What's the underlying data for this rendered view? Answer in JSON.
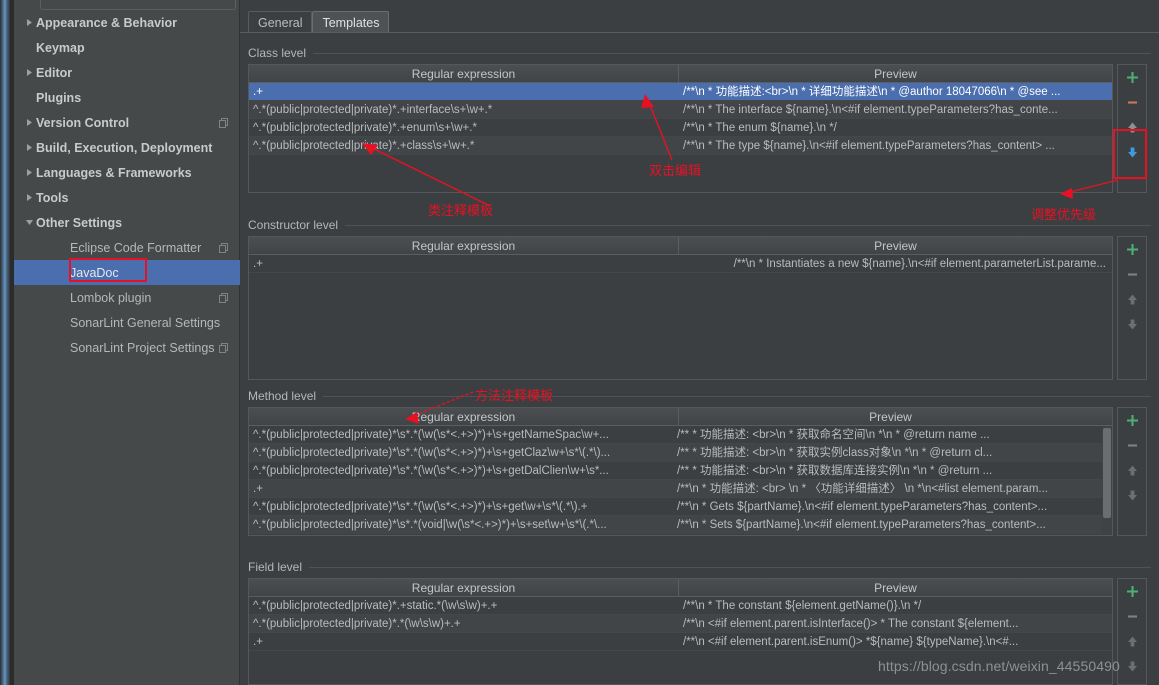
{
  "window": {
    "accent_blue": "#4b6eaf",
    "annotation_red": "#e81123",
    "bg": "#3c3f41",
    "sidebar_bg": "#45494a"
  },
  "search": {
    "value": "",
    "placeholder": ""
  },
  "sidebar": {
    "items": [
      {
        "label": "Appearance & Behavior",
        "level": "top",
        "twisty": "collapsed",
        "copy": false,
        "selected": false
      },
      {
        "label": "Keymap",
        "level": "top",
        "twisty": "none",
        "copy": false,
        "selected": false
      },
      {
        "label": "Editor",
        "level": "top",
        "twisty": "collapsed",
        "copy": false,
        "selected": false
      },
      {
        "label": "Plugins",
        "level": "top",
        "twisty": "none",
        "copy": false,
        "selected": false
      },
      {
        "label": "Version Control",
        "level": "top",
        "twisty": "collapsed",
        "copy": true,
        "selected": false
      },
      {
        "label": "Build, Execution, Deployment",
        "level": "top",
        "twisty": "collapsed",
        "copy": false,
        "selected": false
      },
      {
        "label": "Languages & Frameworks",
        "level": "top",
        "twisty": "collapsed",
        "copy": false,
        "selected": false
      },
      {
        "label": "Tools",
        "level": "top",
        "twisty": "collapsed",
        "copy": false,
        "selected": false
      },
      {
        "label": "Other Settings",
        "level": "top",
        "twisty": "expanded",
        "copy": false,
        "selected": false
      },
      {
        "label": "Eclipse Code Formatter",
        "level": "child",
        "twisty": "none",
        "copy": true,
        "selected": false
      },
      {
        "label": "JavaDoc",
        "level": "child",
        "twisty": "none",
        "copy": false,
        "selected": true
      },
      {
        "label": "Lombok plugin",
        "level": "child",
        "twisty": "none",
        "copy": true,
        "selected": false
      },
      {
        "label": "SonarLint General Settings",
        "level": "child",
        "twisty": "none",
        "copy": false,
        "selected": false
      },
      {
        "label": "SonarLint Project Settings",
        "level": "child",
        "twisty": "none",
        "copy": true,
        "selected": false
      }
    ]
  },
  "tabs": [
    {
      "label": "General",
      "active": false
    },
    {
      "label": "Templates",
      "active": true
    }
  ],
  "columns": {
    "regex": "Regular expression",
    "preview": "Preview"
  },
  "sections": {
    "class_level": {
      "title": "Class level",
      "rows": [
        {
          "regex": ".+",
          "preview": "/**\\n * 功能描述:<br>\\n * 详细功能描述\\n * @author 18047066\\n * @see ...",
          "selected": true
        },
        {
          "regex": "^.*(public|protected|private)*.+interface\\s+\\w+.*",
          "preview": "/**\\n * The interface ${name}.\\n<#if element.typeParameters?has_conte...",
          "selected": false
        },
        {
          "regex": "^.*(public|protected|private)*.+enum\\s+\\w+.*",
          "preview": "/**\\n * The enum ${name}.\\n */",
          "selected": false
        },
        {
          "regex": "^.*(public|protected|private)*.+class\\s+\\w+.*",
          "preview": "/**\\n * The type ${name}.\\n<#if element.typeParameters?has_content>  ...",
          "selected": false
        }
      ]
    },
    "constructor_level": {
      "title": "Constructor level",
      "rows": [
        {
          "regex": ".+",
          "preview": "/**\\n * Instantiates a new ${name}.\\n<#if element.parameterList.parame...",
          "selected": false
        }
      ]
    },
    "method_level": {
      "title": "Method level",
      "rows": [
        {
          "regex": "^.*(public|protected|private)*\\s*.*(\\w(\\s*<.+>)*)+\\s+getNameSpac\\w+...",
          "preview": "/**     * 功能描述: <br>\\n     * 获取命名空间\\n     *\\n     * @return name ...",
          "selected": false
        },
        {
          "regex": "^.*(public|protected|private)*\\s*.*(\\w(\\s*<.+>)*)+\\s+getClaz\\w+\\s*\\(.*\\)...",
          "preview": "/**     * 功能描述: <br>\\n     * 获取实例class对象\\n     *\\n     * @return cl...",
          "selected": false
        },
        {
          "regex": "^.*(public|protected|private)*\\s*.*(\\w(\\s*<.+>)*)+\\s+getDalClien\\w+\\s*...",
          "preview": "/**     * 功能描述: <br>\\n     * 获取数据库连接实例\\n     *\\n     * @return ...",
          "selected": false
        },
        {
          "regex": ".+",
          "preview": "/**\\n * 功能描述: <br> \\n * 〈功能详细描述〉 \\n *\\n<#list element.param...",
          "selected": false
        },
        {
          "regex": "^.*(public|protected|private)*\\s*.*(\\w(\\s*<.+>)*)+\\s+get\\w+\\s*\\(.*\\).+",
          "preview": "/**\\n * Gets ${partName}.\\n<#if element.typeParameters?has_content>...",
          "selected": false
        },
        {
          "regex": "^.*(public|protected|private)*\\s*.*(void|\\w(\\s*<.+>)*)+\\s+set\\w+\\s*\\(.*\\...",
          "preview": "/**\\n * Sets ${partName}.\\n<#if element.typeParameters?has_content>...",
          "selected": false
        }
      ]
    },
    "field_level": {
      "title": "Field level",
      "rows": [
        {
          "regex": "^.*(public|protected|private)*.+static.*(\\w\\s\\w)+.+",
          "preview": "/**\\n * The constant ${element.getName()}.\\n */",
          "selected": false
        },
        {
          "regex": "^.*(public|protected|private)*.*(\\w\\s\\w)+.+",
          "preview": "/**\\n   <#if element.parent.isInterface()>      * The constant ${element...",
          "selected": false
        },
        {
          "regex": ".+",
          "preview": "/**\\n   <#if element.parent.isEnum()>      *${name} ${typeName}.\\n<#...",
          "selected": false
        }
      ]
    }
  },
  "toolbar": {
    "add_label": "+",
    "remove_label": "−",
    "move_up_label": "move up",
    "move_down_label": "move down"
  },
  "annotations": [
    {
      "id": "class-template",
      "text": "类注释模板"
    },
    {
      "id": "double-click-edit",
      "text": "双击编辑"
    },
    {
      "id": "adjust-priority",
      "text": "调整优先级"
    },
    {
      "id": "method-template",
      "text": "方法注释模板"
    }
  ],
  "watermark": "https://blog.csdn.net/weixin_44550490"
}
